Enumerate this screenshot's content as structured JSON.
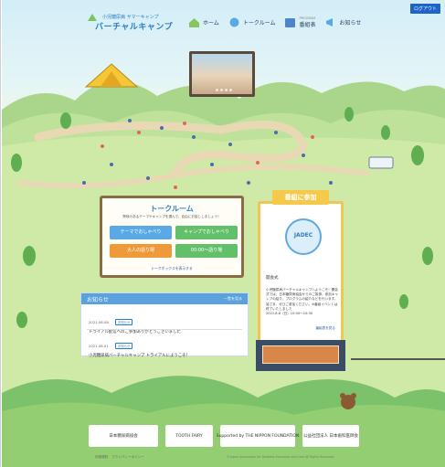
{
  "header": {
    "logout_label": "ログアウト",
    "logo_small": "小児糖尿病 サマーキャンプ",
    "logo_big": "バーチャルキャンプ"
  },
  "nav": {
    "home": "ホーム",
    "talkroom": "トークルーム",
    "program": "番組表",
    "program_sub": "PROGRAM",
    "news": "お知らせ"
  },
  "talkroom": {
    "title": "トークルーム",
    "description": "興味のあるテーマやキャンプを選んで、自由にお話ししましょう！",
    "buttons": [
      "テーマでおしゃべり",
      "キャンプでおしゃべり",
      "大人の語り場",
      "00:00〜語り場"
    ],
    "more": "トークボックスを表示する"
  },
  "news": {
    "title": "お知らせ",
    "all": "一覧を見る",
    "items": [
      {
        "date": "2021.08.08",
        "tag": "お知らせ",
        "text": "トライアル配信へのご参加ありがとうございました"
      },
      {
        "date": "2021.08.01",
        "tag": "お知らせ",
        "text": "小児糖尿病バーチャルキャンプ トライアルにようこそ！"
      }
    ]
  },
  "join": {
    "banner": "番組に参加",
    "logo_text": "JADEC",
    "subtitle": "開会式",
    "body": "小児糖尿病バーチャルキャンプへようこそ！開会式では、日本糖尿病協会からのご挨拶、参加キャンプの紹介、プログラムの紹介などを行います。皆さま、ぜひご参加ください。※番組イベントは終了いたしました",
    "time": "2021.8.8（日）10:00〜10:30",
    "link": "番組表を見る"
  },
  "footer": {
    "sponsors": [
      "日本糖尿病協会",
      "TOOTH FAIRY",
      "Supported by THE NIPPON FOUNDATION",
      "公益社団法人 日本歯科医師会"
    ],
    "links": "利用規約　プライバシーポリシー",
    "copyright": "© Japan Association for Diabetes Education and Care All Rights Reserved."
  },
  "colors": {
    "accent": "#2d7fc1",
    "btn_blue": "#5aa9e6",
    "btn_green": "#63c06a",
    "btn_orange": "#ef9a3a",
    "board_wood": "#8b6b45",
    "join_yellow": "#f7c94a"
  }
}
